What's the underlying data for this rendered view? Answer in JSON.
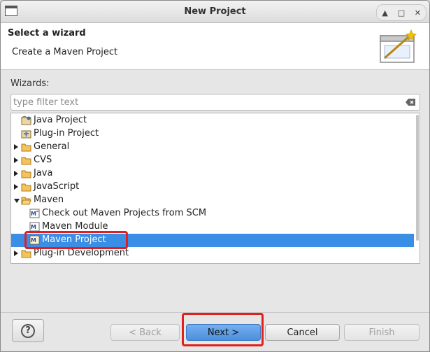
{
  "window": {
    "title": "New Project"
  },
  "header": {
    "title": "Select a wizard",
    "description": "Create a Maven Project"
  },
  "wizards": {
    "label": "Wizards:",
    "filter_placeholder": "type filter text",
    "items": [
      {
        "label": "Java Project",
        "icon": "java-project-icon",
        "expander": "none",
        "indent": 0
      },
      {
        "label": "Plug-in Project",
        "icon": "plugin-project-icon",
        "expander": "none",
        "indent": 0
      },
      {
        "label": "General",
        "icon": "folder-icon",
        "expander": "closed",
        "indent": 0
      },
      {
        "label": "CVS",
        "icon": "folder-icon",
        "expander": "closed",
        "indent": 0
      },
      {
        "label": "Java",
        "icon": "folder-icon",
        "expander": "closed",
        "indent": 0
      },
      {
        "label": "JavaScript",
        "icon": "folder-icon",
        "expander": "closed",
        "indent": 0
      },
      {
        "label": "Maven",
        "icon": "folder-open-icon",
        "expander": "open",
        "indent": 0
      },
      {
        "label": "Check out Maven Projects from SCM",
        "icon": "maven-checkout-icon",
        "expander": "none",
        "indent": 1
      },
      {
        "label": "Maven Module",
        "icon": "maven-module-icon",
        "expander": "none",
        "indent": 1
      },
      {
        "label": "Maven Project",
        "icon": "maven-project-icon",
        "expander": "none",
        "indent": 1,
        "selected": true
      },
      {
        "label": "Plug-in Development",
        "icon": "folder-icon",
        "expander": "closed",
        "indent": 0
      }
    ]
  },
  "buttons": {
    "help": "?",
    "back": "< Back",
    "next": "Next >",
    "cancel": "Cancel",
    "finish": "Finish"
  },
  "colors": {
    "selection": "#3a8ee6",
    "highlight_annotation": "#e02020",
    "primary_button": "#4d8fdd"
  }
}
